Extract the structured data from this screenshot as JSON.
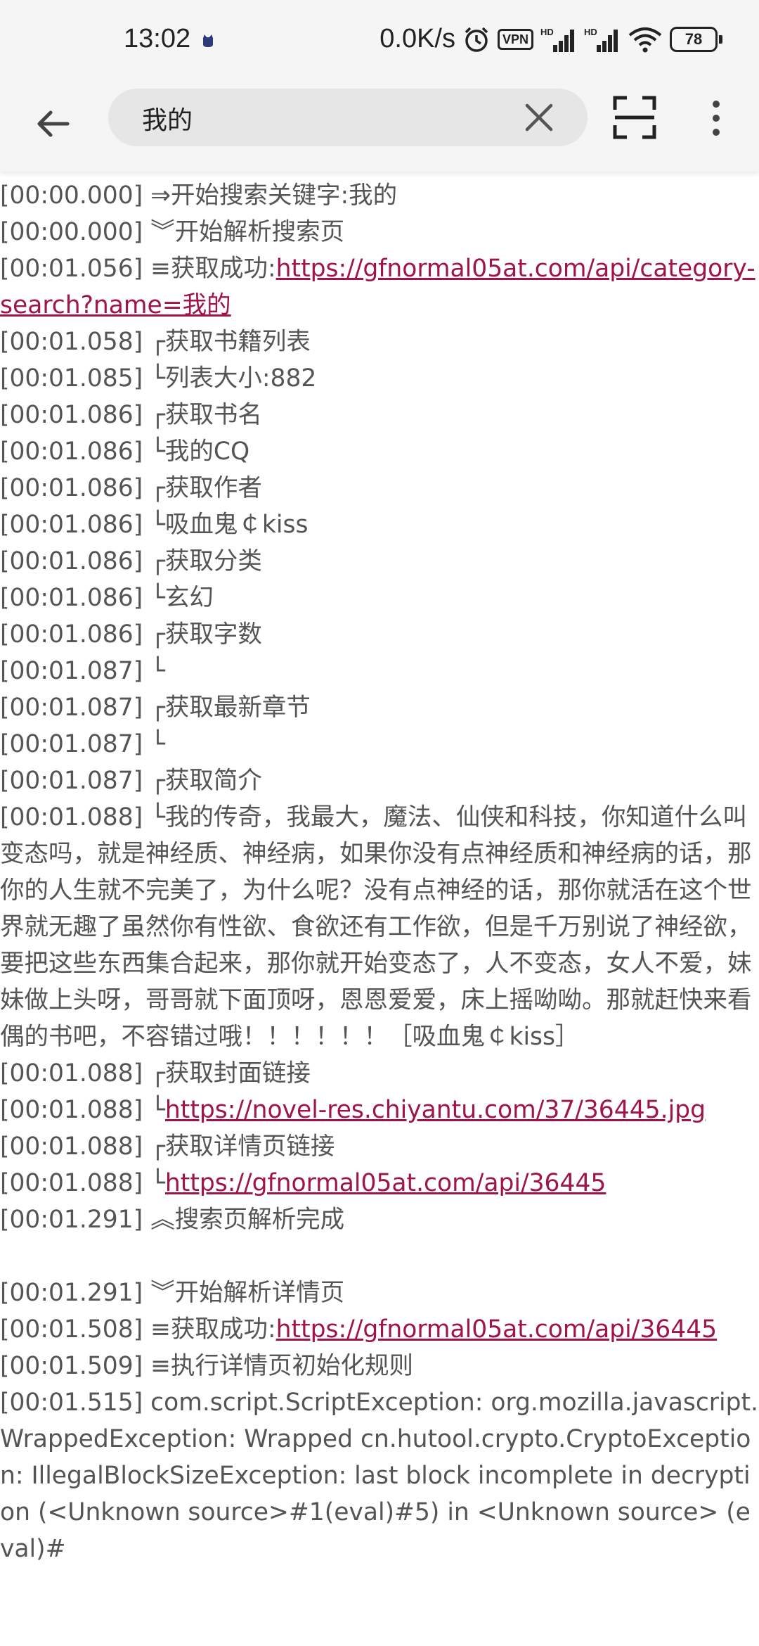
{
  "status_bar": {
    "time": "13:02",
    "network_speed": "0.0K/s",
    "vpn_label": "VPN",
    "hd1": "HD",
    "hd2": "HD",
    "battery": "78"
  },
  "toolbar": {
    "search_value": "我的"
  },
  "log": [
    {
      "ts": "[00:00.000]",
      "text": " ⇒开始搜索关键字:我的"
    },
    {
      "ts": "[00:00.000]",
      "text": " ︾开始解析搜索页"
    },
    {
      "ts": "[00:01.056]",
      "text": " ≡获取成功:",
      "link": "https://gfnormal05at.com/api/category-search?name=我的"
    },
    {
      "ts": "[00:01.058]",
      "text": " ┌获取书籍列表"
    },
    {
      "ts": "[00:01.085]",
      "text": " └列表大小:882"
    },
    {
      "ts": "[00:01.086]",
      "text": " ┌获取书名"
    },
    {
      "ts": "[00:01.086]",
      "text": " └我的CQ"
    },
    {
      "ts": "[00:01.086]",
      "text": " ┌获取作者"
    },
    {
      "ts": "[00:01.086]",
      "text": " └吸血鬼￠kiss"
    },
    {
      "ts": "[00:01.086]",
      "text": " ┌获取分类"
    },
    {
      "ts": "[00:01.086]",
      "text": " └玄幻"
    },
    {
      "ts": "[00:01.086]",
      "text": " ┌获取字数"
    },
    {
      "ts": "[00:01.087]",
      "text": " └"
    },
    {
      "ts": "[00:01.087]",
      "text": " ┌获取最新章节"
    },
    {
      "ts": "[00:01.087]",
      "text": " └"
    },
    {
      "ts": "[00:01.087]",
      "text": " ┌获取简介"
    },
    {
      "ts": "[00:01.088]",
      "text": " └我的传奇，我最大，魔法、仙侠和科技，你知道什么叫变态吗，就是神经质、神经病，如果你没有点神经质和神经病的话，那你的人生就不完美了，为什么呢？没有点神经的话，那你就活在这个世界就无趣了虽然你有性欲、食欲还有工作欲，但是千万别说了神经欲，要把这些东西集合起来，那你就开始变态了，人不变态，女人不爱，妹妹做上头呀，哥哥就下面顶呀，恩恩爱爱，床上摇呦呦。那就赶快来看偶的书吧，不容错过哦！！！！！！［吸血鬼￠kiss］"
    },
    {
      "ts": "[00:01.088]",
      "text": " ┌获取封面链接"
    },
    {
      "ts": "[00:01.088]",
      "text": " └",
      "link": "https://novel-res.chiyantu.com/37/36445.jpg"
    },
    {
      "ts": "[00:01.088]",
      "text": " ┌获取详情页链接"
    },
    {
      "ts": "[00:01.088]",
      "text": " └",
      "link": "https://gfnormal05at.com/api/36445"
    },
    {
      "ts": "[00:01.291]",
      "text": " ︽搜索页解析完成"
    },
    {
      "ts": "",
      "text": ""
    },
    {
      "ts": "[00:01.291]",
      "text": " ︾开始解析详情页"
    },
    {
      "ts": "[00:01.508]",
      "text": " ≡获取成功:",
      "link": "https://gfnormal05at.com/api/36445"
    },
    {
      "ts": "[00:01.509]",
      "text": " ≡执行详情页初始化规则"
    },
    {
      "ts": "[00:01.515]",
      "text": " com.script.ScriptException: org.mozilla.javascript.WrappedException: Wrapped cn.hutool.crypto.CryptoException: IllegalBlockSizeException: last block incomplete in decryption (<Unknown source>#1(eval)#5) in <Unknown source> (eval)#"
    }
  ]
}
